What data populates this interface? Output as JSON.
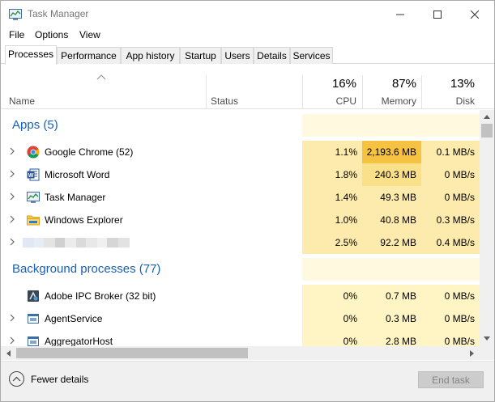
{
  "window": {
    "title": "Task Manager"
  },
  "menu": [
    "File",
    "Options",
    "View"
  ],
  "tabs": [
    "Processes",
    "Performance",
    "App history",
    "Startup",
    "Users",
    "Details",
    "Services"
  ],
  "active_tab": "Processes",
  "columns": {
    "name": "Name",
    "status": "Status",
    "cpu": {
      "percent": "16%",
      "label": "CPU"
    },
    "memory": {
      "percent": "87%",
      "label": "Memory"
    },
    "disk": {
      "percent": "13%",
      "label": "Disk"
    }
  },
  "groups": {
    "apps": {
      "title": "Apps (5)"
    },
    "background": {
      "title": "Background processes (77)"
    }
  },
  "apps": [
    {
      "name": "Google Chrome (52)",
      "icon": "chrome-icon",
      "cpu": "1.1%",
      "memory": "2,193.6 MB",
      "disk": "0.1 MB/s"
    },
    {
      "name": "Microsoft Word",
      "icon": "word-icon",
      "cpu": "1.8%",
      "memory": "240.3 MB",
      "disk": "0 MB/s"
    },
    {
      "name": "Task Manager",
      "icon": "task-manager-icon",
      "cpu": "1.4%",
      "memory": "49.3 MB",
      "disk": "0 MB/s"
    },
    {
      "name": "Windows Explorer",
      "icon": "folder-icon",
      "cpu": "1.0%",
      "memory": "40.8 MB",
      "disk": "0.3 MB/s"
    },
    {
      "name": "",
      "icon": "redacted-icon",
      "cpu": "2.5%",
      "memory": "92.2 MB",
      "disk": "0.4 MB/s"
    }
  ],
  "background": [
    {
      "name": "Adobe IPC Broker (32 bit)",
      "icon": "adobe-icon",
      "cpu": "0%",
      "memory": "0.7 MB",
      "disk": "0 MB/s"
    },
    {
      "name": "AgentService",
      "icon": "service-icon",
      "cpu": "0%",
      "memory": "0.3 MB",
      "disk": "0 MB/s"
    },
    {
      "name": "AggregatorHost",
      "icon": "service-icon",
      "cpu": "0%",
      "memory": "2.8 MB",
      "disk": "0 MB/s"
    }
  ],
  "footer": {
    "fewer_details": "Fewer details",
    "end_task": "End task"
  },
  "colors": {
    "heat_light": "#fff4c4",
    "heat_mid": "#f9eca8",
    "heat_strong": "#ffd66e",
    "heat_max": "#f6c242",
    "group_title": "#1a5fb4"
  }
}
